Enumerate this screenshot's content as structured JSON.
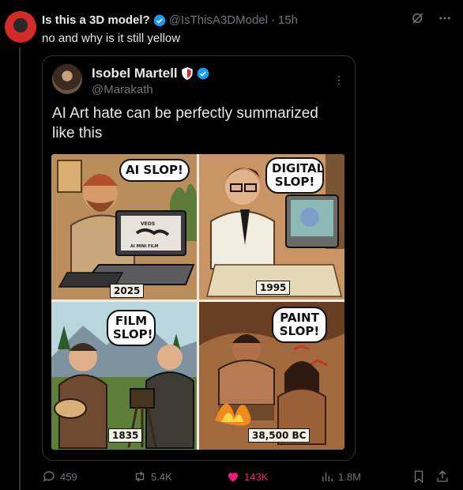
{
  "post": {
    "author_name": "Is this a 3D model?",
    "author_handle": "@IsThisA3DModel",
    "separator": "·",
    "time": "15h",
    "text": "no and why is it still yellow"
  },
  "quote": {
    "author_name": "Isobel Martell",
    "author_handle": "@Marakath",
    "text": "AI Art hate can be perfectly summarized like this",
    "image": {
      "panels": [
        {
          "bubble": "AI SLOP!",
          "year": "2025",
          "screen_label": "AI MINI FILM",
          "tag": "VEOS"
        },
        {
          "bubble": "DIGITAL SLOP!",
          "year": "1995"
        },
        {
          "bubble": "FILM SLOP!",
          "year": "1835"
        },
        {
          "bubble": "PAINT SLOP!",
          "year": "38,500 BC"
        }
      ]
    }
  },
  "actions": {
    "replies": "459",
    "reposts": "5.4K",
    "likes": "143K",
    "views": "1.8M"
  },
  "colors": {
    "background": "#000000",
    "verified": "#1d9bf0",
    "like": "#f91880",
    "muted": "#71767b"
  }
}
